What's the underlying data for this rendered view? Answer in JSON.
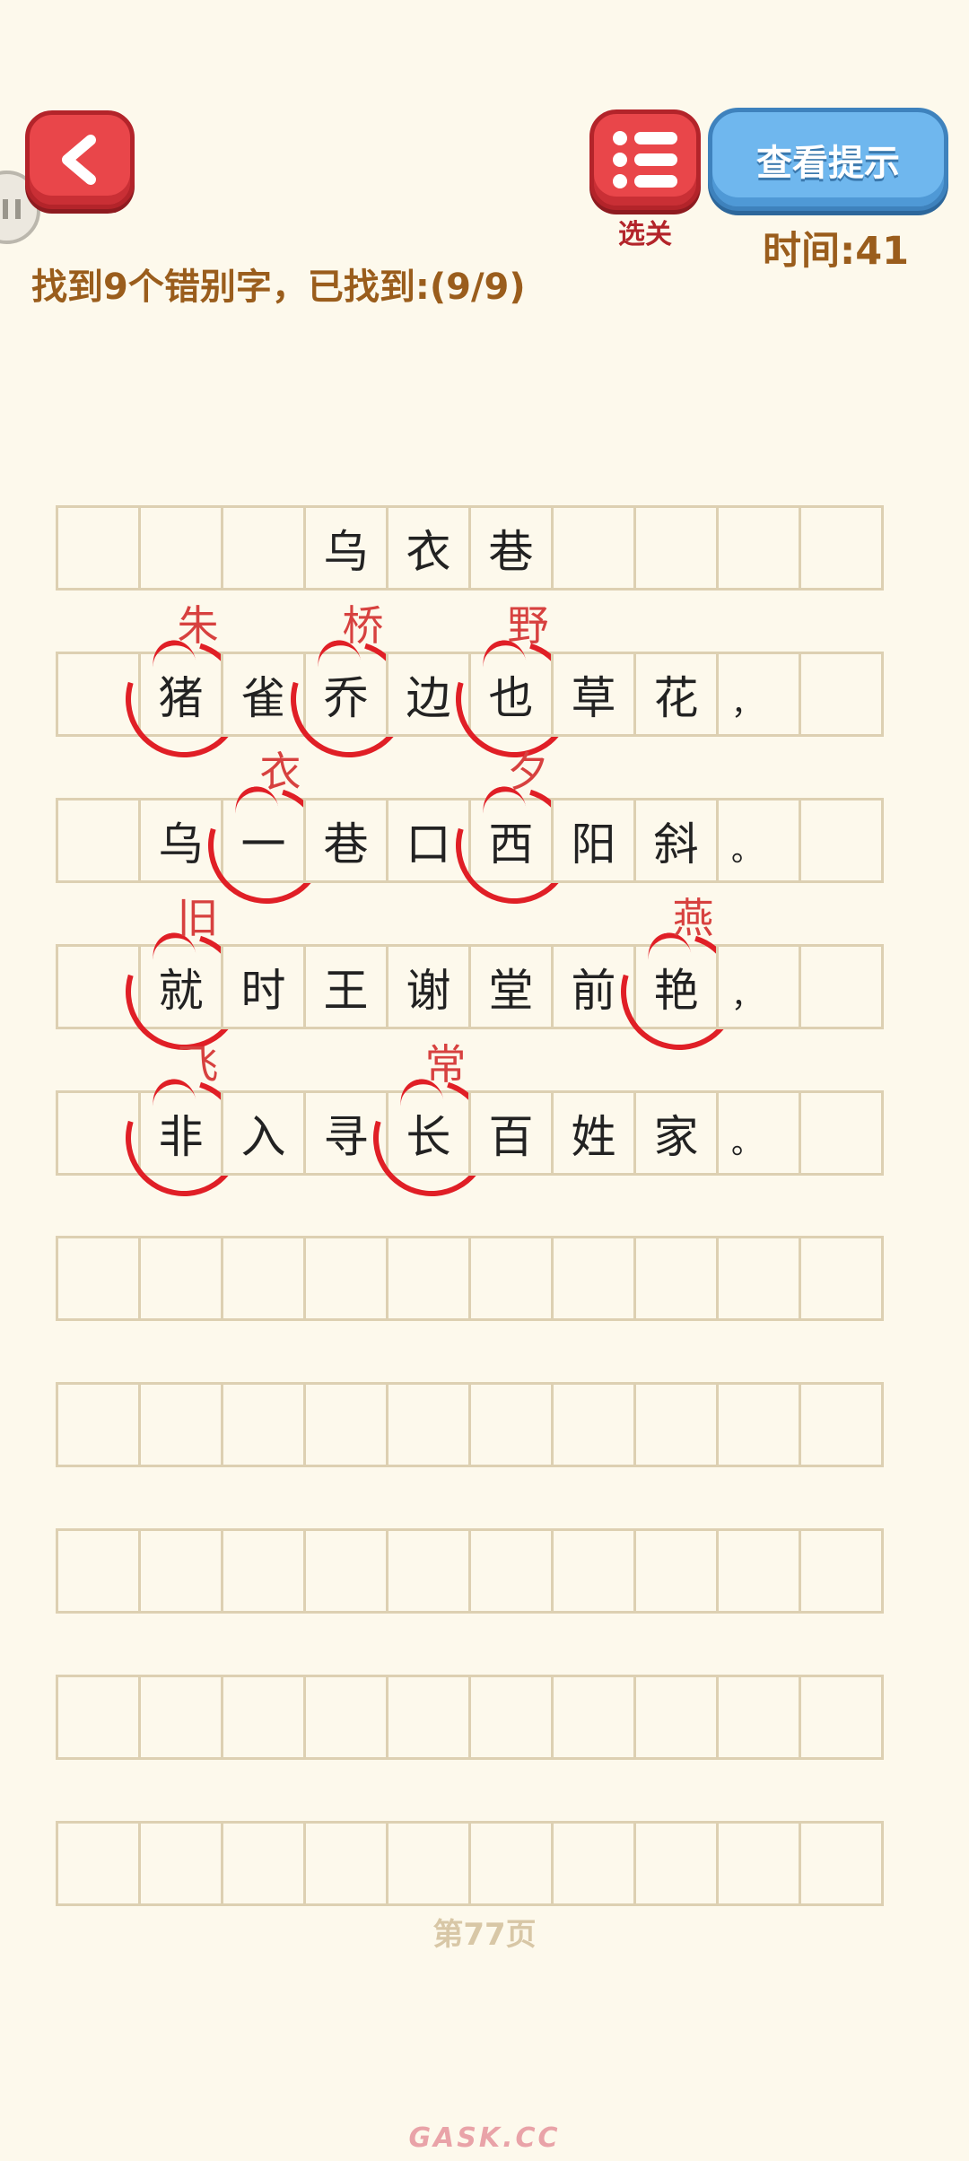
{
  "header": {
    "level_select_label": "选关",
    "hint_label": "查看提示",
    "timer_text": "时间:41",
    "instruction": "找到9个错别字，已找到:(9/9)"
  },
  "icons": {
    "back": "chevron-left-icon",
    "level_select": "list-icon",
    "side": "pause-icon"
  },
  "colors": {
    "accent_red": "#e9464a",
    "hint_blue": "#6fb7ee",
    "text_brown": "#9a5d1c",
    "mark_red": "#e01f26"
  },
  "grid": {
    "rows": [
      [
        {
          "char": ""
        },
        {
          "char": ""
        },
        {
          "char": ""
        },
        {
          "char": "乌"
        },
        {
          "char": "衣"
        },
        {
          "char": "巷"
        },
        {
          "char": ""
        },
        {
          "char": ""
        },
        {
          "char": ""
        },
        {
          "char": ""
        }
      ],
      [
        {
          "char": ""
        },
        {
          "char": "猪",
          "wrong": true,
          "correction": "朱"
        },
        {
          "char": "雀"
        },
        {
          "char": "乔",
          "wrong": true,
          "correction": "桥"
        },
        {
          "char": "边"
        },
        {
          "char": "也",
          "wrong": true,
          "correction": "野"
        },
        {
          "char": "草"
        },
        {
          "char": "花"
        },
        {
          "char": "，",
          "punct": true
        },
        {
          "char": ""
        }
      ],
      [
        {
          "char": ""
        },
        {
          "char": "乌"
        },
        {
          "char": "一",
          "wrong": true,
          "correction": "衣"
        },
        {
          "char": "巷"
        },
        {
          "char": "口"
        },
        {
          "char": "西",
          "wrong": true,
          "correction": "夕"
        },
        {
          "char": "阳"
        },
        {
          "char": "斜"
        },
        {
          "char": "。",
          "punct": true
        },
        {
          "char": ""
        }
      ],
      [
        {
          "char": ""
        },
        {
          "char": "就",
          "wrong": true,
          "correction": "旧"
        },
        {
          "char": "时"
        },
        {
          "char": "王"
        },
        {
          "char": "谢"
        },
        {
          "char": "堂"
        },
        {
          "char": "前"
        },
        {
          "char": "艳",
          "wrong": true,
          "correction": "燕"
        },
        {
          "char": "，",
          "punct": true
        },
        {
          "char": ""
        }
      ],
      [
        {
          "char": ""
        },
        {
          "char": "非",
          "wrong": true,
          "correction": "飞"
        },
        {
          "char": "入"
        },
        {
          "char": "寻"
        },
        {
          "char": "长",
          "wrong": true,
          "correction": "常"
        },
        {
          "char": "百"
        },
        {
          "char": "姓"
        },
        {
          "char": "家"
        },
        {
          "char": "。",
          "punct": true
        },
        {
          "char": ""
        }
      ],
      [
        {
          "char": ""
        },
        {
          "char": ""
        },
        {
          "char": ""
        },
        {
          "char": ""
        },
        {
          "char": ""
        },
        {
          "char": ""
        },
        {
          "char": ""
        },
        {
          "char": ""
        },
        {
          "char": ""
        },
        {
          "char": ""
        }
      ],
      [
        {
          "char": ""
        },
        {
          "char": ""
        },
        {
          "char": ""
        },
        {
          "char": ""
        },
        {
          "char": ""
        },
        {
          "char": ""
        },
        {
          "char": ""
        },
        {
          "char": ""
        },
        {
          "char": ""
        },
        {
          "char": ""
        }
      ],
      [
        {
          "char": ""
        },
        {
          "char": ""
        },
        {
          "char": ""
        },
        {
          "char": ""
        },
        {
          "char": ""
        },
        {
          "char": ""
        },
        {
          "char": ""
        },
        {
          "char": ""
        },
        {
          "char": ""
        },
        {
          "char": ""
        }
      ],
      [
        {
          "char": ""
        },
        {
          "char": ""
        },
        {
          "char": ""
        },
        {
          "char": ""
        },
        {
          "char": ""
        },
        {
          "char": ""
        },
        {
          "char": ""
        },
        {
          "char": ""
        },
        {
          "char": ""
        },
        {
          "char": ""
        }
      ],
      [
        {
          "char": ""
        },
        {
          "char": ""
        },
        {
          "char": ""
        },
        {
          "char": ""
        },
        {
          "char": ""
        },
        {
          "char": ""
        },
        {
          "char": ""
        },
        {
          "char": ""
        },
        {
          "char": ""
        },
        {
          "char": ""
        }
      ]
    ]
  },
  "footer": {
    "page_label": "第77页",
    "watermark": "GASK.CC"
  }
}
